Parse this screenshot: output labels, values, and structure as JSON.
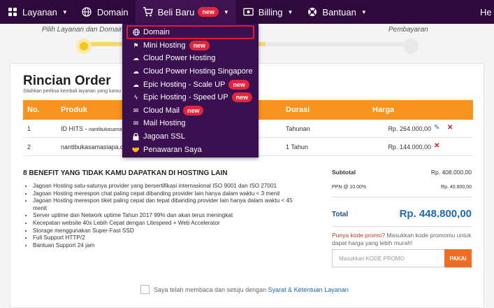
{
  "nav": {
    "items": [
      {
        "label": "Layanan",
        "icon": "grid-icon"
      },
      {
        "label": "Domain",
        "icon": "globe-icon"
      },
      {
        "label": "Beli Baru",
        "icon": "cart-icon",
        "badge": "new"
      },
      {
        "label": "Billing",
        "icon": "billing-icon"
      },
      {
        "label": "Bantuan",
        "icon": "lifebuoy-icon"
      }
    ],
    "right_text": "He"
  },
  "steps": {
    "step1": "Pilih Layanan dan Domain",
    "step3": "Pembayaran"
  },
  "order": {
    "title": "Rincian Order",
    "subtitle": "Silahkan periksa kembali layanan yang kamu",
    "columns": [
      "No.",
      "Produk",
      "Durasi",
      "Harga"
    ],
    "rows": [
      {
        "no": "1",
        "product": "ID HITS",
        "product_detail": "nantibukasama",
        "duration": "Tahunan",
        "price": "Rp. 264.000,00"
      },
      {
        "no": "2",
        "product": "nantibukasamasiapa.c",
        "product_detail": "",
        "duration": "1 Tahun",
        "price": "Rp. 144.000,00"
      }
    ]
  },
  "benefits": {
    "title": "8 BENEFIT YANG TIDAK KAMU DAPATKAN DI HOSTING LAIN",
    "items": [
      "Jagoan Hosting satu-satunya provider yang bersertifikasi internasional ISO 9001 dan ISO 27001",
      "Jagoan Hosting merespon chat paling cepat dibanding provider lain hanya dalam waktu < 3 menit",
      "Jagoan Hosting merespon tiket paling cepat dan tepat dibanding provider lain hanya dalam waktu < 45 menit",
      "Server uptime dan Network uptime Tahun 2017 99% dan akan terus meningkat",
      "Kecepatan website 40x Lebih Cepat dengan Litespeed + Web Accelerator",
      "Storage menggunakan Super-Fast SSD",
      "Full Support HTTP/2",
      "Bantuan Support 24 jam"
    ]
  },
  "summary": {
    "subtotal_label": "Subtotal",
    "subtotal_value": "Rp. 408.000,00",
    "ppn_label": "PPN @ 10.00%",
    "ppn_value": "Rp. 40.800,00",
    "total_label": "Total",
    "total_value": "Rp. 448.800,00",
    "promo_question": "Punya kode promo?",
    "promo_hint": "Masukkan kode promomu untuk dapat harga yang lebih murah!",
    "promo_placeholder": "Masukkan KODE PROMO",
    "promo_button": "PAKAI"
  },
  "tos": {
    "text": "Saya telah membaca dan setuju dengan",
    "link": "Syarat & Ketentuan Layanan"
  },
  "dropdown": {
    "items": [
      {
        "label": "Domain",
        "icon": "globe-icon",
        "badge": ""
      },
      {
        "label": "Mini Hosting",
        "icon": "flag-icon",
        "badge": "new"
      },
      {
        "label": "Cloud Power Hosting",
        "icon": "cloud-icon",
        "badge": ""
      },
      {
        "label": "Cloud Power Hosting Singapore",
        "icon": "cloud-icon",
        "badge": ""
      },
      {
        "label": "Epic Hosting - Scale UP",
        "icon": "cloud-upload-icon",
        "badge": "new"
      },
      {
        "label": "Epic Hosting - Speed UP",
        "icon": "bolt-icon",
        "badge": "new"
      },
      {
        "label": "Cloud Mail",
        "icon": "envelope-icon",
        "badge": "new"
      },
      {
        "label": "Mail Hosting",
        "icon": "envelope-icon",
        "badge": ""
      },
      {
        "label": "Jagoan SSL",
        "icon": "lock-icon",
        "badge": ""
      },
      {
        "label": "Penawaran Saya",
        "icon": "handshake-icon",
        "badge": ""
      }
    ]
  },
  "colors": {
    "nav_bg": "#2e0a3c",
    "accent_orange": "#f7931e",
    "badge_red": "#e5233c",
    "total_blue": "#1b6cb5",
    "progress_yellow": "#f5d76e"
  }
}
